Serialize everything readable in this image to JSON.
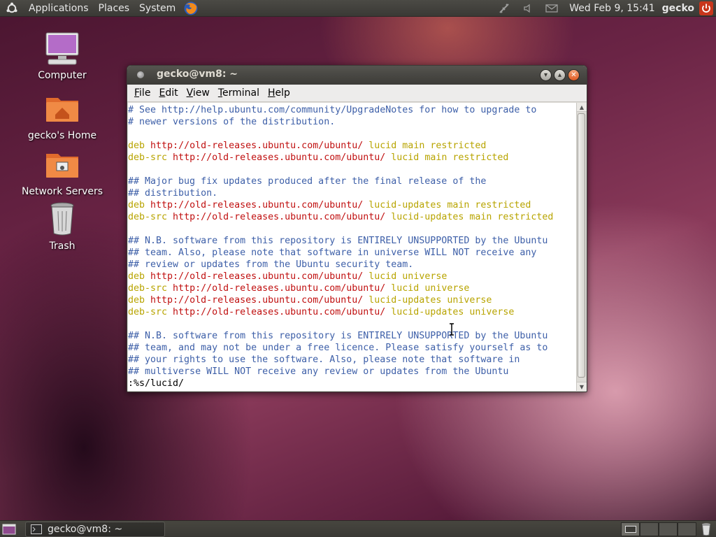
{
  "top_panel": {
    "menus": [
      "Applications",
      "Places",
      "System"
    ],
    "clock": "Wed Feb  9, 15:41",
    "username": "gecko",
    "icons": [
      "ubuntu-logo-icon",
      "firefox-icon",
      "network-icon",
      "volume-icon",
      "mail-icon",
      "power-icon"
    ]
  },
  "desktop": {
    "icons": [
      {
        "label": "Computer",
        "icon": "computer-icon"
      },
      {
        "label": "gecko's Home",
        "icon": "home-folder-icon"
      },
      {
        "label": "Network Servers",
        "icon": "network-folder-icon"
      },
      {
        "label": "Trash",
        "icon": "trash-icon"
      }
    ]
  },
  "terminal": {
    "title": "gecko@vm8: ~",
    "menu": [
      {
        "label": "File",
        "key": "F",
        "rest": "ile"
      },
      {
        "label": "Edit",
        "key": "E",
        "rest": "dit"
      },
      {
        "label": "View",
        "key": "V",
        "rest": "iew"
      },
      {
        "label": "Terminal",
        "key": "T",
        "rest": "erminal"
      },
      {
        "label": "Help",
        "key": "H",
        "rest": "elp"
      }
    ],
    "lines": [
      [
        {
          "t": "# See http://help.ubuntu.com/community/UpgradeNotes for how to upgrade to",
          "c": "comment"
        }
      ],
      [
        {
          "t": "# newer versions of the distribution.",
          "c": "comment"
        }
      ],
      [],
      [
        {
          "t": "deb",
          "c": "deb"
        },
        {
          "t": " http://old-releases.ubuntu.com/ubuntu/",
          "c": "url"
        },
        {
          "t": " lucid",
          "c": "dist"
        },
        {
          "t": " main restricted",
          "c": "comp"
        }
      ],
      [
        {
          "t": "deb-src",
          "c": "deb"
        },
        {
          "t": " http://old-releases.ubuntu.com/ubuntu/",
          "c": "url"
        },
        {
          "t": " lucid",
          "c": "dist"
        },
        {
          "t": " main restricted",
          "c": "comp"
        }
      ],
      [],
      [
        {
          "t": "## Major bug fix updates produced after the final release of the",
          "c": "comment"
        }
      ],
      [
        {
          "t": "## distribution.",
          "c": "comment"
        }
      ],
      [
        {
          "t": "deb",
          "c": "deb"
        },
        {
          "t": " http://old-releases.ubuntu.com/ubuntu/",
          "c": "url"
        },
        {
          "t": " lucid-updates",
          "c": "dist"
        },
        {
          "t": " main restricted",
          "c": "comp"
        }
      ],
      [
        {
          "t": "deb-src",
          "c": "deb"
        },
        {
          "t": " http://old-releases.ubuntu.com/ubuntu/",
          "c": "url"
        },
        {
          "t": " lucid-updates",
          "c": "dist"
        },
        {
          "t": " main restricted",
          "c": "comp"
        }
      ],
      [],
      [
        {
          "t": "## N.B. software from this repository is ENTIRELY UNSUPPORTED by the Ubuntu",
          "c": "comment"
        }
      ],
      [
        {
          "t": "## team. Also, please note that software in universe WILL NOT receive any",
          "c": "comment"
        }
      ],
      [
        {
          "t": "## review or updates from the Ubuntu security team.",
          "c": "comment"
        }
      ],
      [
        {
          "t": "deb",
          "c": "deb"
        },
        {
          "t": " http://old-releases.ubuntu.com/ubuntu/",
          "c": "url"
        },
        {
          "t": " lucid",
          "c": "dist"
        },
        {
          "t": " universe",
          "c": "comp"
        }
      ],
      [
        {
          "t": "deb-src",
          "c": "deb"
        },
        {
          "t": " http://old-releases.ubuntu.com/ubuntu/",
          "c": "url"
        },
        {
          "t": " lucid",
          "c": "dist"
        },
        {
          "t": " universe",
          "c": "comp"
        }
      ],
      [
        {
          "t": "deb",
          "c": "deb"
        },
        {
          "t": " http://old-releases.ubuntu.com/ubuntu/",
          "c": "url"
        },
        {
          "t": " lucid-updates",
          "c": "dist"
        },
        {
          "t": " universe",
          "c": "comp"
        }
      ],
      [
        {
          "t": "deb-src",
          "c": "deb"
        },
        {
          "t": " http://old-releases.ubuntu.com/ubuntu/",
          "c": "url"
        },
        {
          "t": " lucid-updates",
          "c": "dist"
        },
        {
          "t": " universe",
          "c": "comp"
        }
      ],
      [],
      [
        {
          "t": "## N.B. software from this repository is ENTIRELY UNSUPPORTED by the Ubuntu",
          "c": "comment"
        }
      ],
      [
        {
          "t": "## team, and may not be under a free licence. Please satisfy yourself as to",
          "c": "comment"
        }
      ],
      [
        {
          "t": "## your rights to use the software. Also, please note that software in",
          "c": "comment"
        }
      ],
      [
        {
          "t": "## multiverse WILL NOT receive any review or updates from the Ubuntu",
          "c": "comment"
        }
      ],
      [
        {
          "t": ":%s/lucid/",
          "c": "black"
        }
      ]
    ]
  },
  "bottom_panel": {
    "task": "gecko@vm8: ~"
  },
  "colors": {
    "comment": "#3d5fa8",
    "keyword": "#b8a400",
    "url": "#c01010",
    "panel": "#3c3b37",
    "close_button": "#e05a22"
  }
}
